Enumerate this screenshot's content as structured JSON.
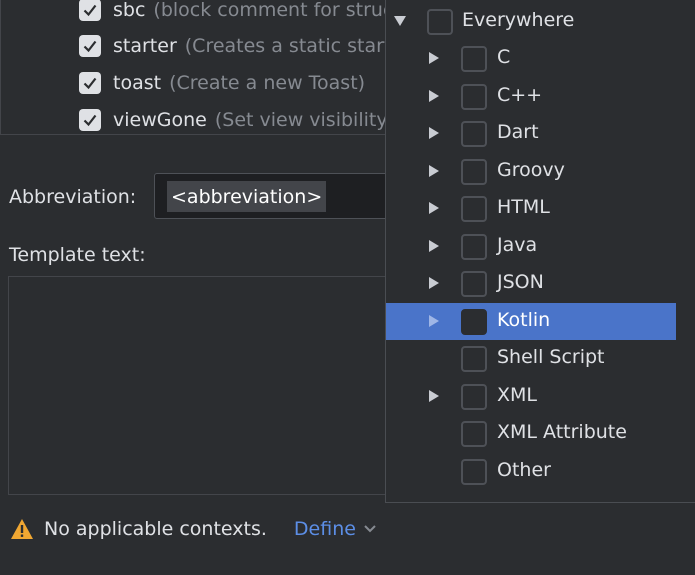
{
  "templates": [
    {
      "name": "sbc",
      "desc": "(block comment for struc",
      "checked": true
    },
    {
      "name": "starter",
      "desc": "(Creates a static start(",
      "checked": true
    },
    {
      "name": "toast",
      "desc": "(Create a new Toast)",
      "checked": true
    },
    {
      "name": "viewGone",
      "desc": "(Set view visibility t",
      "checked": true
    }
  ],
  "abbreviation": {
    "label": "Abbreviation:",
    "value": "<abbreviation>"
  },
  "template_text": {
    "label": "Template text:"
  },
  "footer": {
    "warning": "No applicable contexts.",
    "define": "Define"
  },
  "contexts": [
    {
      "label": "Everywhere",
      "expanded": true,
      "has_children": true,
      "checked": false
    },
    {
      "label": "C",
      "has_children": true,
      "checked": false
    },
    {
      "label": "C++",
      "has_children": true,
      "checked": false
    },
    {
      "label": "Dart",
      "has_children": true,
      "checked": false
    },
    {
      "label": "Groovy",
      "has_children": true,
      "checked": false
    },
    {
      "label": "HTML",
      "has_children": true,
      "checked": false
    },
    {
      "label": "Java",
      "has_children": true,
      "checked": false
    },
    {
      "label": "JSON",
      "has_children": true,
      "checked": false
    },
    {
      "label": "Kotlin",
      "has_children": true,
      "checked": false,
      "selected": true
    },
    {
      "label": "Shell Script",
      "has_children": false,
      "checked": false
    },
    {
      "label": "XML",
      "has_children": true,
      "checked": false
    },
    {
      "label": "XML Attribute",
      "has_children": false,
      "checked": false
    },
    {
      "label": "Other",
      "has_children": false,
      "checked": false
    }
  ],
  "colors": {
    "background": "#2b2d30",
    "selection": "#4a74c9",
    "link": "#5c8ee6",
    "warning": "#f0a732"
  },
  "icons": {
    "check": "check-icon",
    "warning": "warning-icon",
    "expand": "triangle-right-icon",
    "collapse": "triangle-down-icon",
    "dropdown": "chevron-down-icon"
  }
}
